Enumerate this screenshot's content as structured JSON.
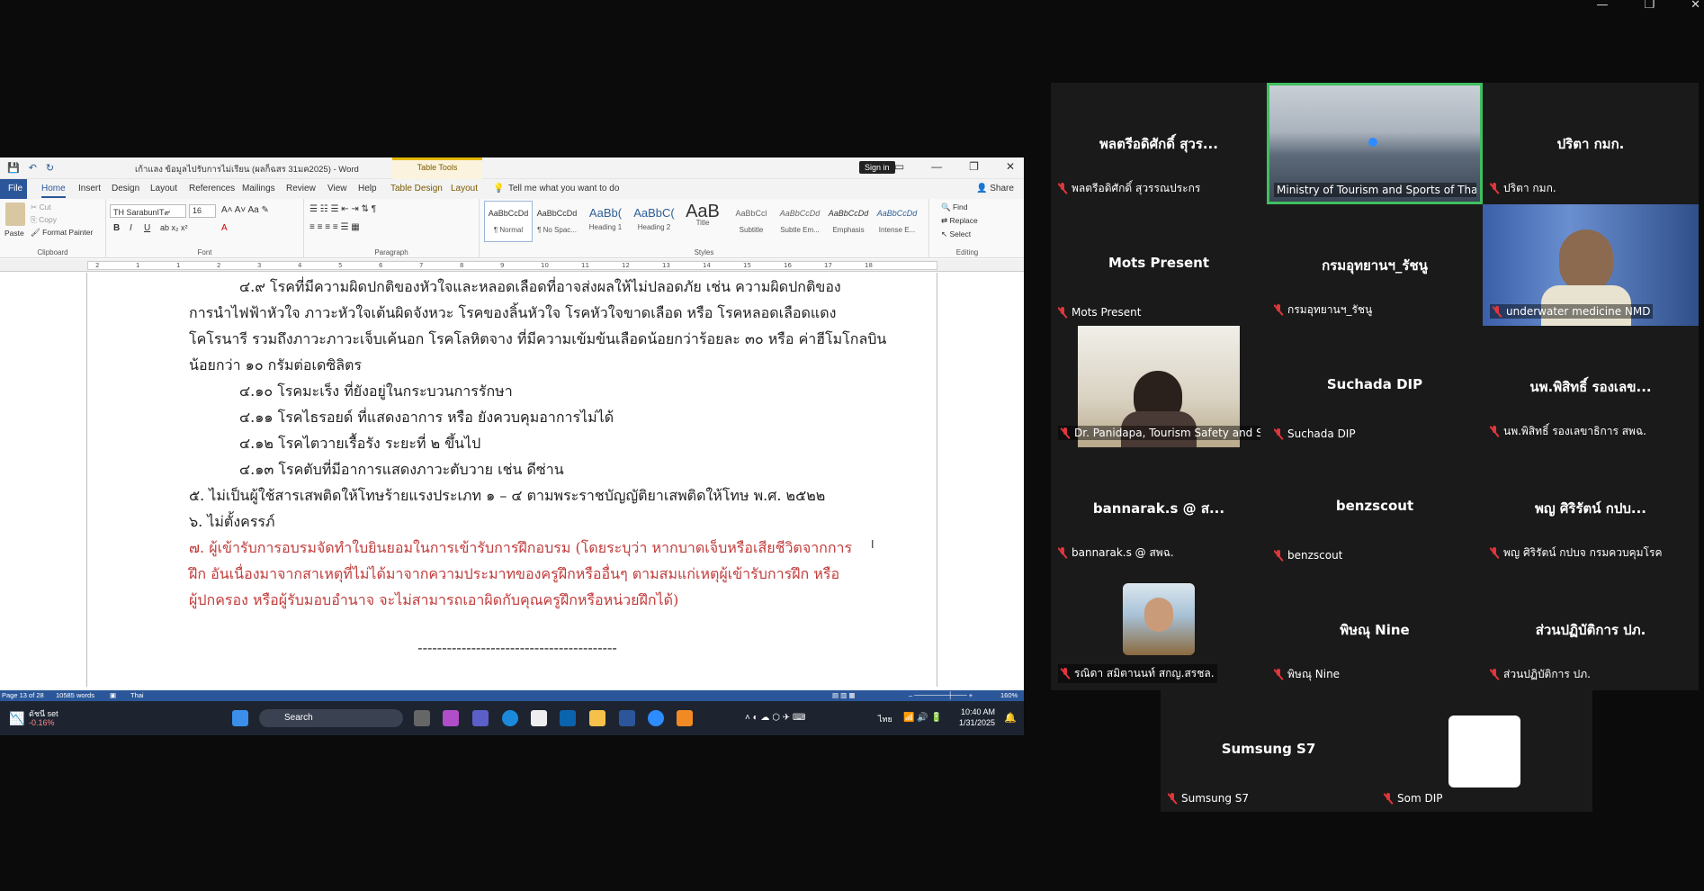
{
  "window_controls": {
    "minimize": "—",
    "restore": "❐",
    "close": "✕"
  },
  "word": {
    "title": "เก้าแลง ข้อมูลไปรับการไม่เรียน (ผลก็ฉสร 31มค2025) - Word",
    "table_tools": "Table Tools",
    "sign_in": "Sign in",
    "tabs": [
      "File",
      "Home",
      "Insert",
      "Design",
      "Layout",
      "References",
      "Mailings",
      "Review",
      "View",
      "Help",
      "Table Design",
      "Layout"
    ],
    "tell_me": "Tell me what you want to do",
    "share": "Share",
    "clipboard": {
      "paste": "Paste",
      "cut": "Cut",
      "copy": "Copy",
      "format_painter": "Format Painter",
      "label": "Clipboard"
    },
    "font": {
      "name": "TH SarabunIT๙",
      "size": "16",
      "label": "Font"
    },
    "paragraph_label": "Paragraph",
    "styles_label": "Styles",
    "styles": [
      {
        "preview": "AaBbCcDd",
        "name": "¶ Normal"
      },
      {
        "preview": "AaBbCcDd",
        "name": "¶ No Spac..."
      },
      {
        "preview": "AaBb(",
        "name": "Heading 1"
      },
      {
        "preview": "AaBbC(",
        "name": "Heading 2"
      },
      {
        "preview": "AaB",
        "name": "Title"
      },
      {
        "preview": "AaBbCcl",
        "name": "Subtitle"
      },
      {
        "preview": "AaBbCcDd",
        "name": "Subtle Em..."
      },
      {
        "preview": "AaBbCcDd",
        "name": "Emphasis"
      },
      {
        "preview": "AaBbCcDd",
        "name": "Intense E..."
      }
    ],
    "editing": {
      "find": "Find",
      "replace": "Replace",
      "select": "Select",
      "label": "Editing"
    },
    "ruler_ticks": [
      "2",
      "1",
      "1",
      "2",
      "3",
      "4",
      "5",
      "6",
      "7",
      "8",
      "9",
      "10",
      "11",
      "12",
      "13",
      "14",
      "15",
      "16",
      "17",
      "18"
    ],
    "document": {
      "lines": [
        {
          "text": "๔.๙ โรคที่มีความผิดปกติของหัวใจและหลอดเลือดที่อาจส่งผลให้ไม่ปลอดภัย เช่น ความผิดปกติของ",
          "indent": true,
          "red": false
        },
        {
          "text": "การนำไฟฟ้าหัวใจ ภาวะหัวใจเต้นผิดจังหวะ โรคของลิ้นหัวใจ โรคหัวใจขาดเลือด หรือ โรคหลอดเลือดแดง",
          "indent": false,
          "red": false
        },
        {
          "text": "โคโรนารี รวมถึงภาวะภาวะเจ็บเค้นอก โรคโลหิตจาง ที่มีความเข้มข้นเลือดน้อยกว่าร้อยละ ๓๐ หรือ ค่าฮีโมโกลบิน",
          "indent": false,
          "red": false
        },
        {
          "text": "น้อยกว่า ๑๐ กรัมต่อเดซิลิตร",
          "indent": false,
          "red": false
        },
        {
          "text": "๔.๑๐ โรคมะเร็ง ที่ยังอยู่ในกระบวนการรักษา",
          "indent": true,
          "red": false
        },
        {
          "text": "๔.๑๑ โรคไธรอยด์ ที่แสดงอาการ หรือ ยังควบคุมอาการไม่ได้",
          "indent": true,
          "red": false
        },
        {
          "text": "๔.๑๒ โรคไตวายเรื้อรัง ระยะที่ ๒ ขึ้นไป",
          "indent": true,
          "red": false
        },
        {
          "text": "๔.๑๓ โรคตับที่มีอาการแสดงภาวะตับวาย เช่น ดีซ่าน",
          "indent": true,
          "red": false
        },
        {
          "text": "๕. ไม่เป็นผู้ใช้สารเสพติดให้โทษร้ายแรงประเภท ๑ – ๔ ตามพระราชบัญญัติยาเสพติดให้โทษ พ.ศ. ๒๕๒๒",
          "indent": false,
          "red": false
        },
        {
          "text": "๖. ไม่ตั้งครรภ์",
          "indent": false,
          "red": false
        },
        {
          "text": "๗. ผู้เข้ารับการอบรมจัดทำใบยินยอมในการเข้ารับการฝึกอบรม (โดยระบุว่า หากบาดเจ็บหรือเสียชีวิตจากการ",
          "indent": false,
          "red": true
        },
        {
          "text": "ฝึก อันเนื่องมาจากสาเหตุที่ไม่ได้มาจากความประมาทของครูฝึกหรืออื่นๆ ตามสมแก่เหตุผู้เข้ารับการฝึก หรือ",
          "indent": false,
          "red": true
        },
        {
          "text": "ผู้ปกครอง หรือผู้รับมอบอำนาจ จะไม่สามารถเอาผิดกับคุณครูฝึกหรือหน่วยฝึกได้)",
          "indent": false,
          "red": true
        }
      ],
      "separator": "-----------------------------------------"
    },
    "status": {
      "page": "Page 13 of 28",
      "words": "10585 words",
      "lang": "Thai",
      "zoom": "160%"
    }
  },
  "taskbar": {
    "stock_name": "ดัชนี set",
    "stock_change": "-0.16%",
    "search": "Search",
    "tray_lang": "ไทย",
    "time": "10:40 AM",
    "date": "1/31/2025"
  },
  "zoom_tiles": [
    {
      "big": "พลตรีอดิศักดิ์ สุวร...",
      "label": "พลตรีอดิศักดิ์ สุวรรณประกร",
      "muted": true
    },
    {
      "big": "",
      "label": "Ministry of Tourism and Sports of Thai...",
      "muted": false,
      "video": true,
      "active": true
    },
    {
      "big": "ปริตา กมก.",
      "label": "ปริตา กมก.",
      "muted": true
    },
    {
      "big": "Mots Present",
      "label": "Mots Present",
      "muted": true
    },
    {
      "big": "กรมอุทยานฯ_รัชนู",
      "label": "กรมอุทยานฯ_รัชนู",
      "muted": true
    },
    {
      "big": "",
      "label": "underwater medicine NMD",
      "muted": true,
      "video": true
    },
    {
      "big": "",
      "label": "Dr. Panidapa, Tourism Safety and S...",
      "muted": true,
      "video": true
    },
    {
      "big": "Suchada DIP",
      "label": "Suchada DIP",
      "muted": true
    },
    {
      "big": "นพ.พิสิทธิ์ รองเลข...",
      "label": "นพ.พิสิทธิ์ รองเลขาธิการ สพฉ.",
      "muted": true
    },
    {
      "big": "bannarak.s @ ส...",
      "label": "bannarak.s @ สพฉ.",
      "muted": true
    },
    {
      "big": "benzscout",
      "label": "benzscout",
      "muted": true
    },
    {
      "big": "พญ ศิริรัตน์ กปบ...",
      "label": "พญ ศิริรัตน์ กปบจ กรมควบคุมโรค",
      "muted": true
    },
    {
      "big": "",
      "label": "รณิดา สมิตานนท์ สกญ.สรชล.",
      "muted": true,
      "avatar": true
    },
    {
      "big": "พิษณุ Nine",
      "label": "พิษณุ Nine",
      "muted": true
    },
    {
      "big": "ส่วนปฏิบัติการ ปภ.",
      "label": "ส่วนปฏิบัติการ ปภ.",
      "muted": true
    },
    {
      "big": "Sumsung S7",
      "label": "Sumsung S7",
      "muted": true
    },
    {
      "big": "",
      "label": "Som DIP",
      "muted": true,
      "blank": true
    }
  ]
}
